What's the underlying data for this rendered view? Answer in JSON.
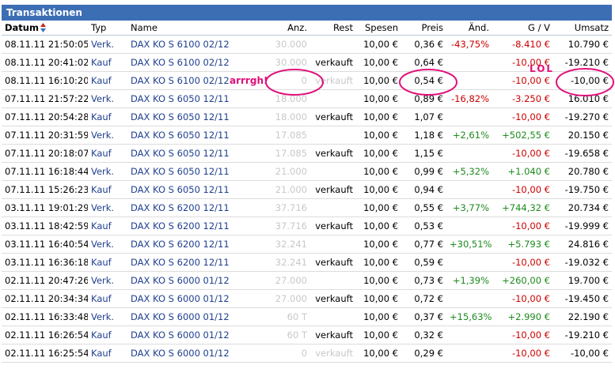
{
  "panel": {
    "title": "Transaktionen"
  },
  "columns": {
    "datum": "Datum",
    "typ": "Typ",
    "name": "Name",
    "anz": "Anz.",
    "rest": "Rest",
    "spesen": "Spesen",
    "preis": "Preis",
    "aend": "Änd.",
    "gv": "G / V",
    "umsatz": "Umsatz"
  },
  "sort_icon": "sort-up-down-icon",
  "colors": {
    "title_bar": "#3c6eb4",
    "loss": "#cc0000",
    "gain": "#1e8a1e",
    "link": "#1f3f8f",
    "annotation": "#e0107a"
  },
  "rows": [
    {
      "datum": "08.11.11 21:50:05",
      "typ": "Verk.",
      "name": "DAX KO S 6100 02/12",
      "anz": "30.000",
      "rest": "",
      "spesen": "10,00 €",
      "preis": "0,36 €",
      "aend": "-43,75%",
      "gv": "-8.410 €",
      "umsatz": "10.790 €",
      "aend_color": "red",
      "gv_color": "red"
    },
    {
      "datum": "08.11.11 20:41:02",
      "typ": "Kauf",
      "name": "DAX KO S 6100 02/12",
      "anz": "30.000",
      "rest": "verkauft",
      "spesen": "10,00 €",
      "preis": "0,64 €",
      "aend": "",
      "gv": "-10,00 €",
      "umsatz": "-19.210 €",
      "aend_color": "",
      "gv_color": "red"
    },
    {
      "datum": "08.11.11 16:10:20",
      "typ": "Kauf",
      "name": "DAX KO S 6100 02/12",
      "anz": "0",
      "rest": "verkauft",
      "spesen": "10,00 €",
      "preis": "0,54 €",
      "aend": "",
      "gv": "-10,00 €",
      "umsatz": "-10,00 €",
      "aend_color": "",
      "gv_color": "red",
      "rest_grey": true
    },
    {
      "datum": "07.11.11 21:57:22",
      "typ": "Verk.",
      "name": "DAX KO S 6050 12/11",
      "anz": "18.000",
      "rest": "",
      "spesen": "10,00 €",
      "preis": "0,89 €",
      "aend": "-16,82%",
      "gv": "-3.250 €",
      "umsatz": "16.010 €",
      "aend_color": "red",
      "gv_color": "red"
    },
    {
      "datum": "07.11.11 20:54:28",
      "typ": "Kauf",
      "name": "DAX KO S 6050 12/11",
      "anz": "18.000",
      "rest": "verkauft",
      "spesen": "10,00 €",
      "preis": "1,07 €",
      "aend": "",
      "gv": "-10,00 €",
      "umsatz": "-19.270 €",
      "aend_color": "",
      "gv_color": "red"
    },
    {
      "datum": "07.11.11 20:31:59",
      "typ": "Verk.",
      "name": "DAX KO S 6050 12/11",
      "anz": "17.085",
      "rest": "",
      "spesen": "10,00 €",
      "preis": "1,18 €",
      "aend": "+2,61%",
      "gv": "+502,55 €",
      "umsatz": "20.150 €",
      "aend_color": "green",
      "gv_color": "green"
    },
    {
      "datum": "07.11.11 20:18:07",
      "typ": "Kauf",
      "name": "DAX KO S 6050 12/11",
      "anz": "17.085",
      "rest": "verkauft",
      "spesen": "10,00 €",
      "preis": "1,15 €",
      "aend": "",
      "gv": "-10,00 €",
      "umsatz": "-19.658 €",
      "aend_color": "",
      "gv_color": "red"
    },
    {
      "datum": "07.11.11 16:18:44",
      "typ": "Verk.",
      "name": "DAX KO S 6050 12/11",
      "anz": "21.000",
      "rest": "",
      "spesen": "10,00 €",
      "preis": "0,99 €",
      "aend": "+5,32%",
      "gv": "+1.040 €",
      "umsatz": "20.780 €",
      "aend_color": "green",
      "gv_color": "green"
    },
    {
      "datum": "07.11.11 15:26:23",
      "typ": "Kauf",
      "name": "DAX KO S 6050 12/11",
      "anz": "21.000",
      "rest": "verkauft",
      "spesen": "10,00 €",
      "preis": "0,94 €",
      "aend": "",
      "gv": "-10,00 €",
      "umsatz": "-19.750 €",
      "aend_color": "",
      "gv_color": "red"
    },
    {
      "datum": "03.11.11 19:01:29",
      "typ": "Verk.",
      "name": "DAX KO S 6200 12/11",
      "anz": "37.716",
      "rest": "",
      "spesen": "10,00 €",
      "preis": "0,55 €",
      "aend": "+3,77%",
      "gv": "+744,32 €",
      "umsatz": "20.734 €",
      "aend_color": "green",
      "gv_color": "green"
    },
    {
      "datum": "03.11.11 18:42:59",
      "typ": "Kauf",
      "name": "DAX KO S 6200 12/11",
      "anz": "37.716",
      "rest": "verkauft",
      "spesen": "10,00 €",
      "preis": "0,53 €",
      "aend": "",
      "gv": "-10,00 €",
      "umsatz": "-19.999 €",
      "aend_color": "",
      "gv_color": "red"
    },
    {
      "datum": "03.11.11 16:40:54",
      "typ": "Verk.",
      "name": "DAX KO S 6200 12/11",
      "anz": "32.241",
      "rest": "",
      "spesen": "10,00 €",
      "preis": "0,77 €",
      "aend": "+30,51%",
      "gv": "+5.793 €",
      "umsatz": "24.816 €",
      "aend_color": "green",
      "gv_color": "green"
    },
    {
      "datum": "03.11.11 16:36:18",
      "typ": "Kauf",
      "name": "DAX KO S 6200 12/11",
      "anz": "32.241",
      "rest": "verkauft",
      "spesen": "10,00 €",
      "preis": "0,59 €",
      "aend": "",
      "gv": "-10,00 €",
      "umsatz": "-19.032 €",
      "aend_color": "",
      "gv_color": "red"
    },
    {
      "datum": "02.11.11 20:47:26",
      "typ": "Verk.",
      "name": "DAX KO S 6000 01/12",
      "anz": "27.000",
      "rest": "",
      "spesen": "10,00 €",
      "preis": "0,73 €",
      "aend": "+1,39%",
      "gv": "+260,00 €",
      "umsatz": "19.700 €",
      "aend_color": "green",
      "gv_color": "green"
    },
    {
      "datum": "02.11.11 20:34:34",
      "typ": "Kauf",
      "name": "DAX KO S 6000 01/12",
      "anz": "27.000",
      "rest": "verkauft",
      "spesen": "10,00 €",
      "preis": "0,72 €",
      "aend": "",
      "gv": "-10,00 €",
      "umsatz": "-19.450 €",
      "aend_color": "",
      "gv_color": "red"
    },
    {
      "datum": "02.11.11 16:33:48",
      "typ": "Verk.",
      "name": "DAX KO S 6000 01/12",
      "anz": "60 T",
      "rest": "",
      "spesen": "10,00 €",
      "preis": "0,37 €",
      "aend": "+15,63%",
      "gv": "+2.990 €",
      "umsatz": "22.190 €",
      "aend_color": "green",
      "gv_color": "green"
    },
    {
      "datum": "02.11.11 16:26:54",
      "typ": "Kauf",
      "name": "DAX KO S 6000 01/12",
      "anz": "60 T",
      "rest": "verkauft",
      "spesen": "10,00 €",
      "preis": "0,32 €",
      "aend": "",
      "gv": "-10,00 €",
      "umsatz": "-19.210 €",
      "aend_color": "",
      "gv_color": "red"
    },
    {
      "datum": "02.11.11 16:25:54",
      "typ": "Kauf",
      "name": "DAX KO S 6000 01/12",
      "anz": "0",
      "rest": "verkauft",
      "spesen": "10,00 €",
      "preis": "0,29 €",
      "aend": "",
      "gv": "-10,00 €",
      "umsatz": "-10,00 €",
      "aend_color": "",
      "gv_color": "red",
      "rest_grey": true
    }
  ],
  "annotations": {
    "arrrgh": "arrrgh!",
    "lol": "LOL"
  }
}
